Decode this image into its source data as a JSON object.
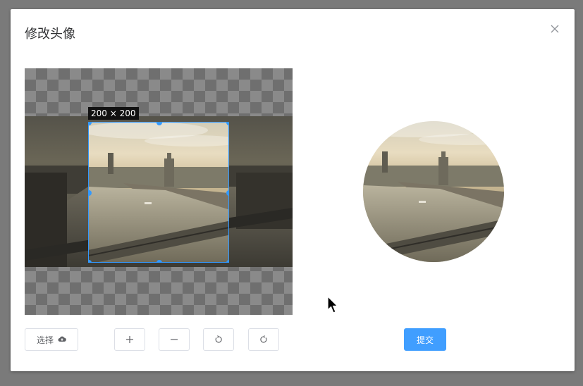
{
  "dialog": {
    "title": "修改头像",
    "close_icon": "close-icon"
  },
  "cropper": {
    "size_label": "200 × 200"
  },
  "toolbar": {
    "select_label": "选择",
    "select_icon": "upload-cloud-icon",
    "zoom_in_icon": "plus-icon",
    "zoom_out_icon": "minus-icon",
    "rotate_left_icon": "rotate-left-icon",
    "rotate_right_icon": "rotate-right-icon",
    "submit_label": "提交"
  },
  "colors": {
    "accent": "#409eff",
    "crop_border": "#3399ff"
  }
}
